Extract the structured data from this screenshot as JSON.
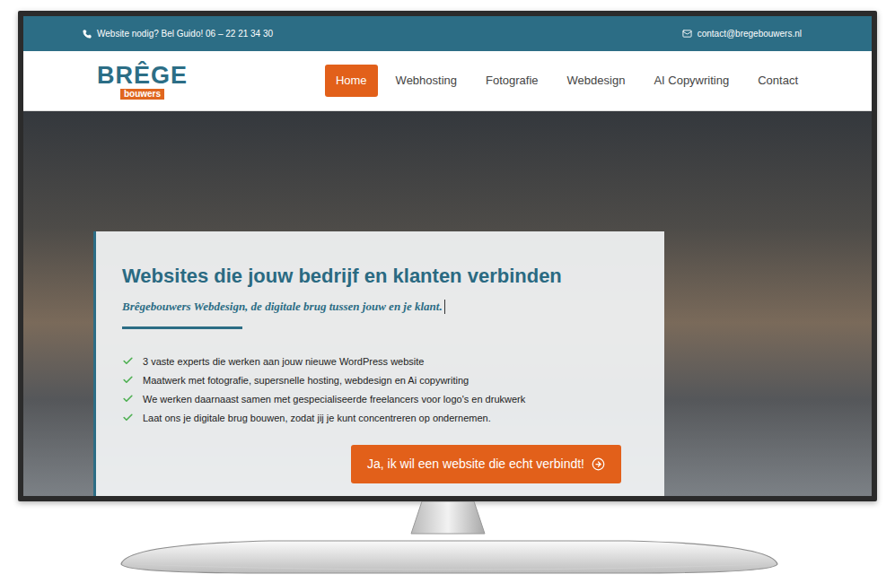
{
  "topbar": {
    "phone": "Website nodig? Bel Guido! 06 – 22 21 34 30",
    "email": "contact@bregebouwers.nl"
  },
  "logo": {
    "name": "BRÊGE",
    "tag": "bouwers"
  },
  "nav": [
    {
      "label": "Home",
      "selected": true
    },
    {
      "label": "Webhosting",
      "selected": false
    },
    {
      "label": "Fotografie",
      "selected": false
    },
    {
      "label": "Webdesign",
      "selected": false
    },
    {
      "label": "AI Copywriting",
      "selected": false
    },
    {
      "label": "Contact",
      "selected": false
    }
  ],
  "hero": {
    "heading": "Websites die jouw bedrijf en klanten verbinden",
    "subtitle": "Brêgebouwers Webdesign, de digitale brug tussen jouw en je klant.",
    "bullets": [
      "3 vaste experts die werken aan jouw nieuwe WordPress website",
      "Maatwerk met fotografie, supersnelle hosting, webdesign en Ai copywriting",
      "We werken daarnaast samen met gespecialiseerde freelancers voor logo's en drukwerk",
      "Laat ons je digitale brug bouwen, zodat jij je kunt concentreren op ondernemen."
    ],
    "button": "Ja, ik wil een website die echt verbindt!"
  }
}
